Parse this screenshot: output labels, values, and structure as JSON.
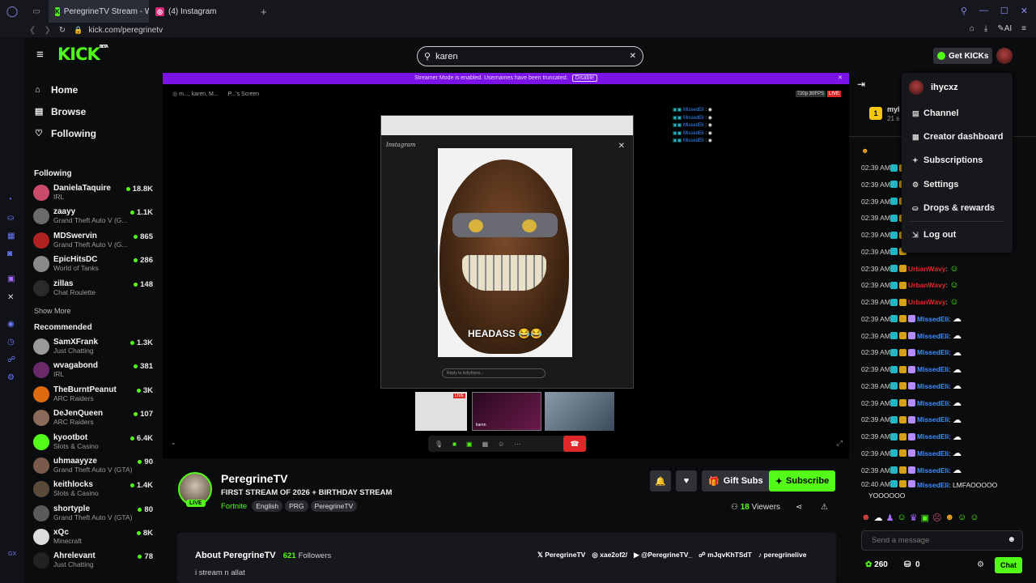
{
  "browser": {
    "tabs": [
      {
        "title": "PeregrineTV Stream - Wat",
        "icon": "kick-favicon"
      },
      {
        "title": "(4) Instagram",
        "icon": "instagram-favicon"
      }
    ],
    "url": "kick.com/peregrinetv",
    "ai_label": "AI",
    "rail_label": "GX"
  },
  "header": {
    "logo": "KICK",
    "logo_sup": "BETA",
    "search_value": "karen",
    "get_kicks_label": "Get KICKs"
  },
  "nav": [
    {
      "label": "Home",
      "icon": "home-icon"
    },
    {
      "label": "Browse",
      "icon": "browse-icon"
    },
    {
      "label": "Following",
      "icon": "heart-icon"
    }
  ],
  "following_title": "Following",
  "following": [
    {
      "name": "DanielaTaquire",
      "game": "IRL",
      "viewers": "18.8K",
      "color": "#c94a6a"
    },
    {
      "name": "zaayy",
      "game": "Grand Theft Auto V (G...",
      "viewers": "1.1K",
      "color": "#6b6b6b"
    },
    {
      "name": "MDSwervin",
      "game": "Grand Theft Auto V (G...",
      "viewers": "865",
      "color": "#b02222"
    },
    {
      "name": "EpicHitsDC",
      "game": "World of Tanks",
      "viewers": "286",
      "color": "#8a8a8a"
    },
    {
      "name": "zillas",
      "game": "Chat Roulette",
      "viewers": "148",
      "color": "#2a2a2a"
    }
  ],
  "show_more": "Show More",
  "recommended_title": "Recommended",
  "recommended": [
    {
      "name": "SamXFrank",
      "game": "Just Chatting",
      "viewers": "1.3K",
      "color": "#9a9a9a"
    },
    {
      "name": "wvagabond",
      "game": "IRL",
      "viewers": "381",
      "color": "#6a2a6a"
    },
    {
      "name": "TheBurntPeanut",
      "game": "ARC Raiders",
      "viewers": "3K",
      "color": "#e06a10"
    },
    {
      "name": "DeJenQueen",
      "game": "ARC Raiders",
      "viewers": "107",
      "color": "#8a6a5a"
    },
    {
      "name": "kyootbot",
      "game": "Slots & Casino",
      "viewers": "6.4K",
      "color": "#53fc18"
    },
    {
      "name": "uhmaayyze",
      "game": "Grand Theft Auto V (GTA)",
      "viewers": "90",
      "color": "#7a5a4a"
    },
    {
      "name": "keithlocks",
      "game": "Slots & Casino",
      "viewers": "1.4K",
      "color": "#5a4a3a"
    },
    {
      "name": "shortyple",
      "game": "Grand Theft Auto V (GTA)",
      "viewers": "80",
      "color": "#5a5a5a"
    },
    {
      "name": "xQc",
      "game": "Minecraft",
      "viewers": "8K",
      "color": "#dddddd"
    },
    {
      "name": "Ahrelevant",
      "game": "Just Chatting",
      "viewers": "78",
      "color": "#222222"
    }
  ],
  "player": {
    "banner": "Streamer Mode is enabled. Usernames have been truncated.",
    "banner_btn": "Disable",
    "top_left_1": "m..., karen, M...",
    "top_left_2": "P...'s Screen",
    "quality": "720p 30FPS",
    "live": "LIVE",
    "meme_caption": "HEADASS 😂😂",
    "overlay_names": [
      "MissedEli",
      "MissedEli",
      "MissedEli",
      "MissedEli",
      "MissedEli"
    ],
    "insta_label": "Instagram",
    "tile_label": "karen",
    "reply_placeholder": "Reply to keliyhiyes..."
  },
  "stream": {
    "channel": "PeregrineTV",
    "title": "FIRST STREAM OF 2026 + BIRTHDAY STREAM",
    "category": "Fortnite",
    "tags": [
      "English",
      "PRG",
      "PeregrineTV"
    ],
    "live_badge": "LIVE",
    "gift_label": "Gift Subs",
    "subscribe_label": "Subscribe",
    "viewers": "18",
    "viewers_label": "Viewers"
  },
  "about": {
    "title": "About PeregrineTV",
    "followers": "621",
    "followers_label": "Followers",
    "bio": "i stream n allat",
    "socials": [
      "PeregrineTV",
      "xae2of2/",
      "@PeregrineTV_",
      "mJqvKhTSdT",
      "peregrinelive"
    ]
  },
  "chat": {
    "pinned_name": "myl",
    "pinned_sub": "21 s",
    "rows": [
      {
        "time": "02:39 AM",
        "user": "",
        "msg": ""
      },
      {
        "time": "02:39 AM",
        "user": "",
        "msg": ""
      },
      {
        "time": "02:39 AM",
        "user": "",
        "msg": ""
      },
      {
        "time": "02:39 AM",
        "user": "",
        "msg": ""
      },
      {
        "time": "02:39 AM",
        "user": "",
        "msg": ""
      },
      {
        "time": "02:39 AM",
        "user": "",
        "msg": ""
      },
      {
        "time": "02:39 AM",
        "user": "UrbanWavy",
        "msg": ""
      },
      {
        "time": "02:39 AM",
        "user": "UrbanWavy",
        "msg": ""
      },
      {
        "time": "02:39 AM",
        "user": "UrbanWavy",
        "msg": ""
      },
      {
        "time": "02:39 AM",
        "user": "MissedEli",
        "msg": ""
      },
      {
        "time": "02:39 AM",
        "user": "MissedEli",
        "msg": ""
      },
      {
        "time": "02:39 AM",
        "user": "MissedEli",
        "msg": ""
      },
      {
        "time": "02:39 AM",
        "user": "MissedEli",
        "msg": ""
      },
      {
        "time": "02:39 AM",
        "user": "MissedEli",
        "msg": ""
      },
      {
        "time": "02:39 AM",
        "user": "MissedEli",
        "msg": ""
      },
      {
        "time": "02:39 AM",
        "user": "MissedEli",
        "msg": ""
      },
      {
        "time": "02:39 AM",
        "user": "MissedEli",
        "msg": ""
      },
      {
        "time": "02:39 AM",
        "user": "MissedEli",
        "msg": ""
      },
      {
        "time": "02:39 AM",
        "user": "MissedEli",
        "msg": ""
      }
    ],
    "last_time": "02:40 AM",
    "last_user": "MissedEli",
    "last_msg_1": "LMFAOOOOO",
    "last_msg_2": "YOOOOOO",
    "input_placeholder": "Send a message",
    "kicks": "260",
    "points": "0",
    "chat_btn": "Chat"
  },
  "menu": {
    "username": "ihycxz",
    "items": [
      {
        "label": "Channel",
        "icon": "channel-icon"
      },
      {
        "label": "Creator dashboard",
        "icon": "dashboard-icon"
      },
      {
        "label": "Subscriptions",
        "icon": "subscriptions-icon"
      },
      {
        "label": "Settings",
        "icon": "gear-icon"
      },
      {
        "label": "Drops & rewards",
        "icon": "drops-icon"
      },
      {
        "label": "Log out",
        "icon": "logout-icon"
      }
    ]
  },
  "colors": {
    "accent": "#53fc18",
    "banner": "#7b12e6",
    "urban": "#e02828",
    "missed": "#3d8bff"
  }
}
